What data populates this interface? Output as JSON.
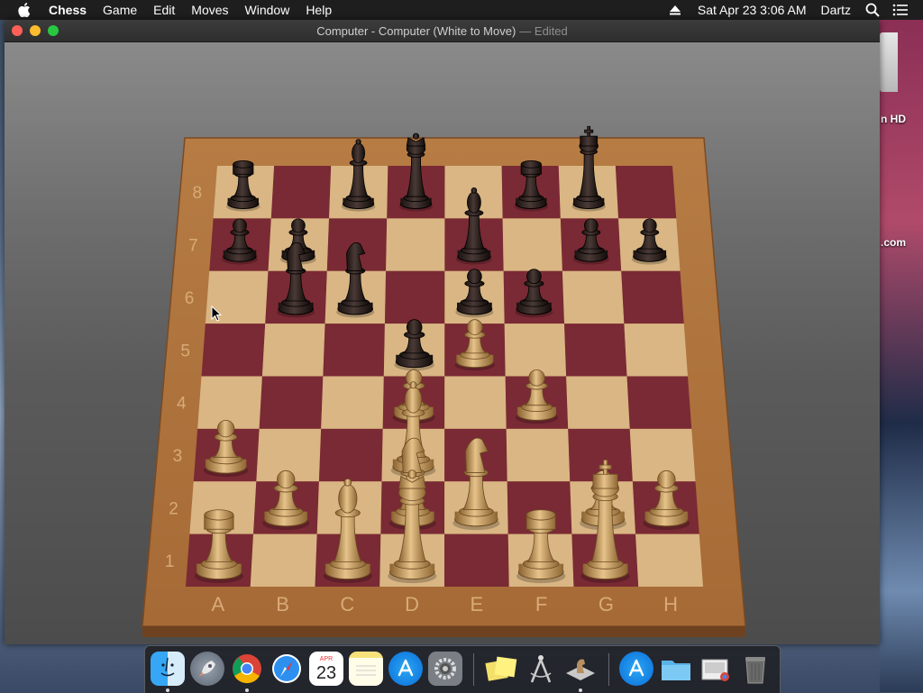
{
  "menubar": {
    "apple_icon": "apple-logo-icon",
    "app_name": "Chess",
    "items": [
      "Game",
      "Edit",
      "Moves",
      "Window",
      "Help"
    ],
    "datetime": "Sat Apr 23  3:06 AM",
    "user": "Dartz"
  },
  "window": {
    "title": "Computer - Computer   (White to Move)",
    "edited": "— Edited"
  },
  "board": {
    "files": [
      "A",
      "B",
      "C",
      "D",
      "E",
      "F",
      "G",
      "H"
    ],
    "ranks": [
      "8",
      "7",
      "6",
      "5",
      "4",
      "3",
      "2",
      "1"
    ]
  },
  "desktop": {
    "hd_label": "n HD",
    "com_label": ".com"
  },
  "dock": {
    "calendar_month": "APR",
    "calendar_day": "23"
  }
}
